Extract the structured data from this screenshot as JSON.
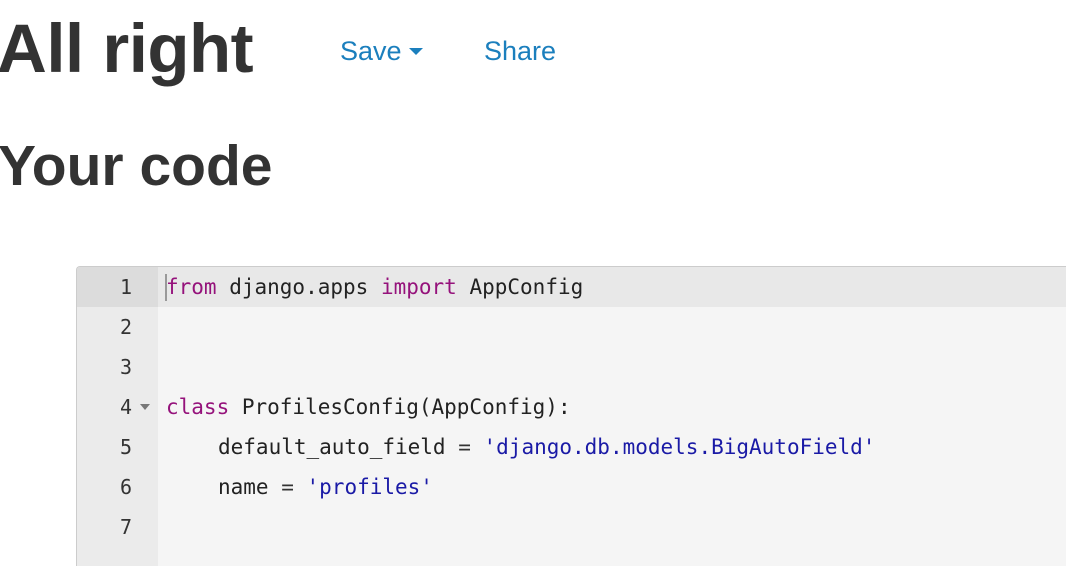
{
  "header": {
    "title": "All right",
    "save_label": "Save",
    "share_label": "Share"
  },
  "section": {
    "title": "Your code"
  },
  "colors": {
    "link": "#1b7fbd",
    "heading": "#333333",
    "keyword": "#95127b",
    "string": "#1a1aa6"
  },
  "editor": {
    "lines": [
      {
        "number": "1",
        "tokens": {
          "t1": "from",
          "t2": " django.apps ",
          "t3": "import",
          "t4": " AppConfig"
        }
      },
      {
        "number": "2"
      },
      {
        "number": "3"
      },
      {
        "number": "4",
        "tokens": {
          "t1": "class",
          "t2": " ProfilesConfig(AppConfig):"
        }
      },
      {
        "number": "5",
        "tokens": {
          "t1": "default_auto_field",
          "t2": " = ",
          "t3": "'django.db.models.BigAutoField'"
        }
      },
      {
        "number": "6",
        "tokens": {
          "t1": "name",
          "t2": " = ",
          "t3": "'profiles'"
        }
      },
      {
        "number": "7"
      }
    ]
  }
}
